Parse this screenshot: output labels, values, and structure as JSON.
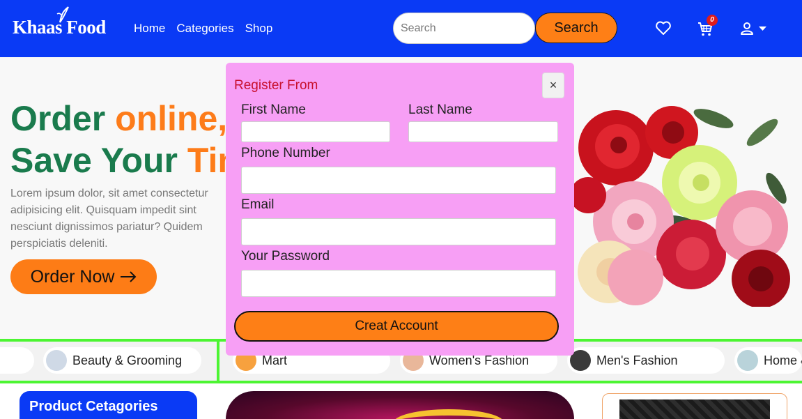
{
  "header": {
    "logo": "Khaas Food",
    "nav": [
      "Home",
      "Categories",
      "Shop"
    ],
    "search_placeholder": "Search",
    "search_button": "Search",
    "cart_count": "0",
    "icons": [
      "heart-icon",
      "cart-icon",
      "user-icon",
      "caret-down-icon"
    ],
    "colors": {
      "brand": "#0a3af5",
      "accent": "#fe7f16"
    }
  },
  "hero": {
    "title_line1_a": "Order ",
    "title_line1_b": "online,",
    "title_line2_a": "Save Your ",
    "title_line2_b": "Time",
    "text": "Lorem ipsum dolor, sit amet consectetur adipisicing elit. Quisquam impedit sint nesciunt dignissimos pariatur? Quidem perspiciatis deleniti.",
    "order_button": "Order Now",
    "colors": {
      "title": "#1a7b4d",
      "accent": "#fd7c1a"
    }
  },
  "categories": [
    {
      "label": "Beauty & Grooming"
    },
    {
      "label": "Mart"
    },
    {
      "label": "Women's Fashion"
    },
    {
      "label": "Men's Fashion"
    },
    {
      "label": "Home & Lifestyle"
    }
  ],
  "sidebar": {
    "title": "Product Cetagories"
  },
  "modal": {
    "title": "Register From",
    "close": "×",
    "first_name_label": "First Name",
    "last_name_label": "Last Name",
    "phone_label": "Phone Number",
    "email_label": "Email",
    "password_label": "Your Password",
    "submit": "Creat Account",
    "colors": {
      "background": "#f79ff5",
      "title": "#c8102e"
    }
  }
}
